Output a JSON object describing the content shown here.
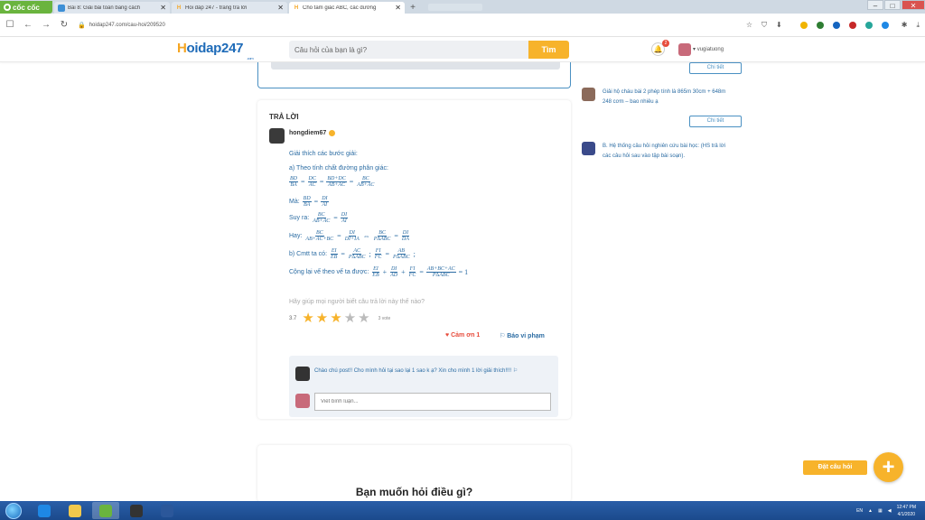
{
  "browser": {
    "brand_label": "cốc cốc",
    "tabs": [
      {
        "title": "Bài 8: Giải bài toán bằng cách",
        "icon_color": "#3d8fd6",
        "active": false
      },
      {
        "title": "Hỏi đáp 247 - trang tra lời",
        "icon_color": "#f5a623",
        "active": false
      },
      {
        "title": "Cho tam giác ABC, các đường",
        "icon_color": "#f5a623",
        "active": true
      }
    ],
    "new_tab_label": "+",
    "url": "hoidap247.com/cau-hoi/209520",
    "window_controls": [
      "–",
      "□",
      "✕"
    ]
  },
  "site": {
    "logo_h": "H",
    "logo_rest": "oidap247",
    "logo_tld": ".com",
    "search_placeholder": "Câu hỏi của bạn là gì?",
    "search_button": "Tìm",
    "notification_count": "2",
    "username": "vugiatuong"
  },
  "answer": {
    "heading": "TRẢ LỜI",
    "author": "hongdiem67",
    "intro": "Giải thích các bước giải:",
    "step_a": "a) Theo tính chất đường phân giác:",
    "eq1": [
      {
        "n": "BD",
        "d": "BA"
      },
      "=",
      {
        "n": "DC",
        "d": "AC"
      },
      "=",
      {
        "n": "BD+DC",
        "d": "AB+AC"
      },
      "=",
      {
        "n": "BC",
        "d": "AB+AC"
      }
    ],
    "ma_label": "Mà:",
    "eq2": [
      {
        "n": "BD",
        "d": "BA"
      },
      "=",
      {
        "n": "DI",
        "d": "AI"
      }
    ],
    "suyra_label": "Suy ra:",
    "eq3": [
      {
        "n": "BC",
        "d": "AB+AC"
      },
      "=",
      {
        "n": "DI",
        "d": "AI"
      }
    ],
    "hay_label": "Hay:",
    "eq4": [
      {
        "n": "BC",
        "d": "AB+AC+BC"
      },
      "=",
      {
        "n": "DI",
        "d": "DI+IA"
      },
      "⇔",
      {
        "n": "BC",
        "d": "P∆ABC"
      },
      "=",
      {
        "n": "DI",
        "d": "DA"
      }
    ],
    "step_b": "b) Cmtt ta có:",
    "eq5": [
      {
        "n": "EI",
        "d": "EB"
      },
      "=",
      {
        "n": "AC",
        "d": "P∆ABC"
      },
      ";",
      {
        "n": "FI",
        "d": "FC"
      },
      "=",
      {
        "n": "AB",
        "d": "P∆ABC"
      },
      ";"
    ],
    "conclude_label": "Cộng lại vế theo vế ta được:",
    "eq6": [
      {
        "n": "EI",
        "d": "EB"
      },
      "+",
      {
        "n": "DI",
        "d": "AD"
      },
      "+",
      {
        "n": "FI",
        "d": "FC"
      },
      "=",
      {
        "n": "AB+BC+AC",
        "d": "P∆ABC"
      },
      "= 1"
    ],
    "help_prompt": "Hãy giúp mọi người biết câu trả lời này thế nào?",
    "rating_score": "3.7",
    "rating_value": 3,
    "rating_max": 5,
    "votes_label": "3 vote",
    "thanks_label": "Cảm ơn 1",
    "report_label": "Báo vi phạm",
    "comment_text": "Chào chú post!! Cho mình hỏi tại sao lại 1 sao k ạ? Xin cho mình 1 lời giải thích!!!!",
    "comment_placeholder": "Viết bình luận..."
  },
  "ask_card": {
    "title": "Bạn muốn hỏi điều gì?"
  },
  "sidebar": {
    "detail_label_1": "Chi tiết",
    "item1": "Giải hộ cháu bài 2 phép tính là 865m 30cm + 648m 248 cơm – bao nhiêu ạ",
    "detail_label_2": "Chi tiết",
    "item2": "B. Hệ thống câu hỏi nghiên cứu bài học: (HS trả lời các câu hỏi sau vào tập bài soạn)."
  },
  "fab": {
    "label": "Đặt câu hỏi",
    "icon": "+"
  },
  "taskbar": {
    "lang": "EN",
    "time": "12:47 PM",
    "date": "4/1/2020"
  },
  "colors": {
    "brand_orange": "#f7b32b",
    "brand_blue": "#1e6bb8",
    "link_blue": "#2b6ca3"
  }
}
